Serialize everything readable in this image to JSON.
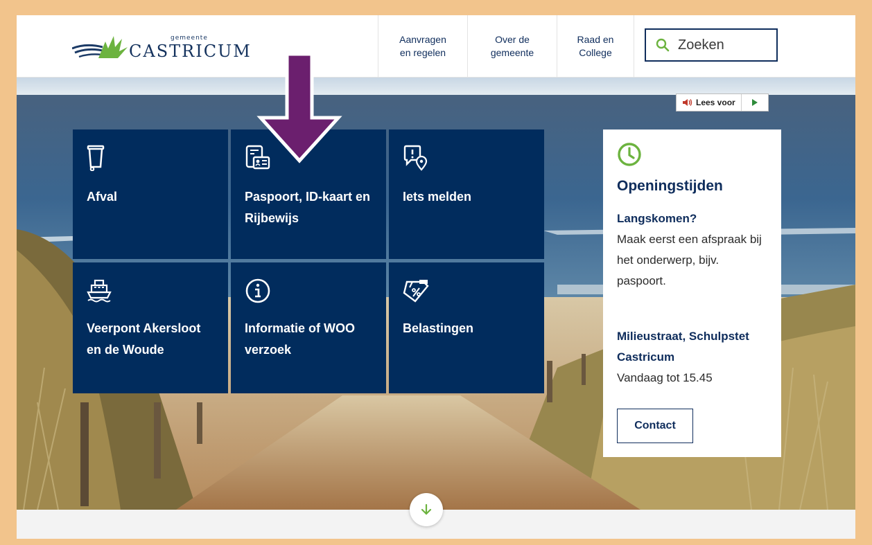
{
  "header": {
    "logo_small": "gemeente",
    "logo_main": "CASTRICUM",
    "nav": [
      {
        "line1": "Aanvragen",
        "line2": "en regelen"
      },
      {
        "line1": "Over de",
        "line2": "gemeente"
      },
      {
        "line1": "Raad en",
        "line2": "College"
      }
    ],
    "search_placeholder": "Zoeken"
  },
  "read_aloud": {
    "label": "Lees voor"
  },
  "tiles": [
    {
      "label": "Afval",
      "icon": "trash-bin-icon"
    },
    {
      "label": "Paspoort, ID-kaart en Rijbewijs",
      "icon": "id-card-icon"
    },
    {
      "label": "Iets melden",
      "icon": "report-location-icon"
    },
    {
      "label": "Veerpont Akersloot en de Woude",
      "icon": "ferry-icon"
    },
    {
      "label": "Informatie of WOO verzoek",
      "icon": "info-icon"
    },
    {
      "label": "Belastingen",
      "icon": "tax-ticket-icon"
    }
  ],
  "opening_hours": {
    "title": "Openingstijden",
    "visit_heading": "Langskomen?",
    "visit_text": "Maak eerst een afspraak bij het onderwerp, bijv. paspoort.",
    "location_heading": "Milieustraat, Schulpstet Castricum",
    "location_hours": "Vandaag tot 15.45",
    "contact_label": "Contact"
  },
  "colors": {
    "tile_bg": "#012c5d",
    "accent_green": "#6cb33f",
    "navy": "#0f2d5c",
    "annotation_arrow": "#6b1f6e",
    "frame_border": "#f2c48c"
  }
}
